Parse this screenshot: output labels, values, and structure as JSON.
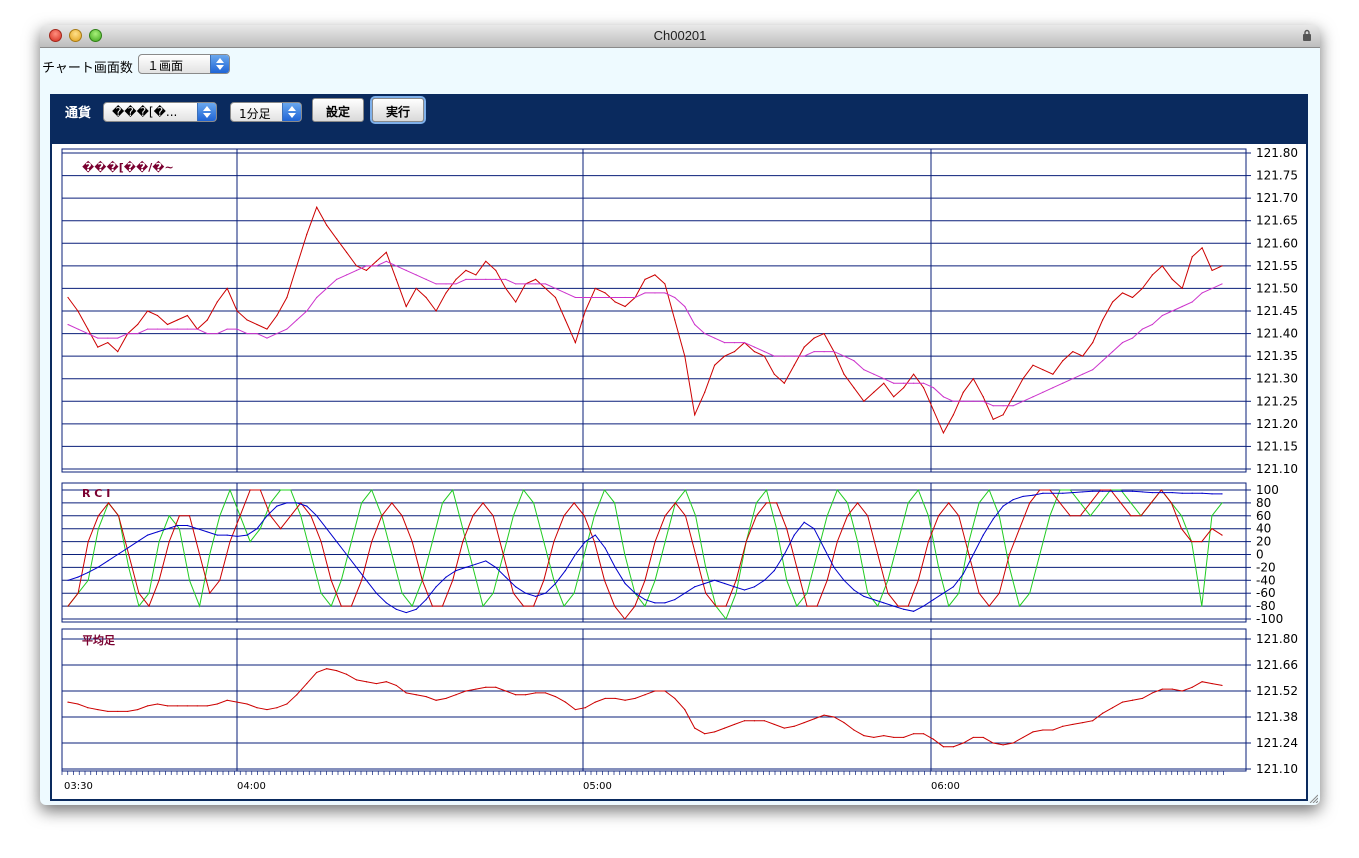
{
  "window": {
    "title": "Ch00201"
  },
  "toolbar": {
    "screen_count_label": "チャート画面数",
    "screen_count_value": "１画面"
  },
  "panel": {
    "currency_label": "通貨",
    "currency_value": "���[�...",
    "timeframe_value": "1分足",
    "settings_button": "設定",
    "execute_button": "実行"
  },
  "chart_data": [
    {
      "type": "line",
      "title": "���[��/�~",
      "ylim": [
        121.1,
        121.8
      ],
      "y_ticks": [
        "121.80",
        "121.75",
        "121.70",
        "121.65",
        "121.60",
        "121.55",
        "121.50",
        "121.45",
        "121.40",
        "121.35",
        "121.30",
        "121.25",
        "121.20",
        "121.15",
        "121.10"
      ],
      "series": [
        {
          "name": "",
          "color": "#cc0000",
          "y": [
            121.48,
            121.45,
            121.41,
            121.37,
            121.38,
            121.36,
            121.4,
            121.42,
            121.45,
            121.44,
            121.42,
            121.43,
            121.44,
            121.41,
            121.43,
            121.47,
            121.5,
            121.45,
            121.43,
            121.42,
            121.41,
            121.44,
            121.48,
            121.55,
            121.62,
            121.68,
            121.64,
            121.61,
            121.58,
            121.55,
            121.54,
            121.56,
            121.58,
            121.52,
            121.46,
            121.5,
            121.48,
            121.45,
            121.49,
            121.52,
            121.54,
            121.53,
            121.56,
            121.54,
            121.5,
            121.47,
            121.51,
            121.52,
            121.5,
            121.48,
            121.43,
            121.38,
            121.45,
            121.5,
            121.49,
            121.47,
            121.46,
            121.48,
            121.52,
            121.53,
            121.51,
            121.43,
            121.35,
            121.22,
            121.27,
            121.33,
            121.35,
            121.36,
            121.38,
            121.36,
            121.35,
            121.31,
            121.29,
            121.33,
            121.37,
            121.39,
            121.4,
            121.36,
            121.31,
            121.28,
            121.25,
            121.27,
            121.29,
            121.26,
            121.28,
            121.31,
            121.28,
            121.23,
            121.18,
            121.22,
            121.27,
            121.3,
            121.26,
            121.21,
            121.22,
            121.26,
            121.3,
            121.33,
            121.32,
            121.31,
            121.34,
            121.36,
            121.35,
            121.38,
            121.43,
            121.47,
            121.49,
            121.48,
            121.5,
            121.53,
            121.55,
            121.52,
            121.5,
            121.57,
            121.59,
            121.54,
            121.55
          ]
        },
        {
          "name": "",
          "color": "#cc33cc",
          "y": [
            121.42,
            121.41,
            121.4,
            121.39,
            121.39,
            121.39,
            121.4,
            121.4,
            121.41,
            121.41,
            121.41,
            121.41,
            121.41,
            121.41,
            121.4,
            121.4,
            121.41,
            121.41,
            121.4,
            121.4,
            121.39,
            121.4,
            121.41,
            121.43,
            121.45,
            121.48,
            121.5,
            121.52,
            121.53,
            121.54,
            121.55,
            121.55,
            121.56,
            121.55,
            121.54,
            121.53,
            121.52,
            121.51,
            121.51,
            121.51,
            121.52,
            121.52,
            121.52,
            121.52,
            121.52,
            121.51,
            121.51,
            121.51,
            121.51,
            121.5,
            121.49,
            121.48,
            121.48,
            121.48,
            121.48,
            121.48,
            121.48,
            121.48,
            121.49,
            121.49,
            121.49,
            121.48,
            121.46,
            121.42,
            121.4,
            121.39,
            121.38,
            121.38,
            121.38,
            121.37,
            121.36,
            121.35,
            121.35,
            121.35,
            121.35,
            121.36,
            121.36,
            121.36,
            121.35,
            121.34,
            121.32,
            121.31,
            121.3,
            121.29,
            121.29,
            121.29,
            121.29,
            121.28,
            121.26,
            121.25,
            121.25,
            121.25,
            121.25,
            121.24,
            121.24,
            121.24,
            121.25,
            121.26,
            121.27,
            121.28,
            121.29,
            121.3,
            121.31,
            121.32,
            121.34,
            121.36,
            121.38,
            121.39,
            121.41,
            121.42,
            121.44,
            121.45,
            121.46,
            121.47,
            121.49,
            121.5,
            121.51
          ]
        }
      ]
    },
    {
      "type": "line",
      "title": "R C I",
      "ylim": [
        -100,
        100
      ],
      "y_ticks": [
        "100",
        "80",
        "60",
        "40",
        "20",
        "0",
        "-20",
        "-40",
        "-60",
        "-80",
        "-100"
      ],
      "series": [
        {
          "name": "",
          "color": "#22cc22",
          "y": [
            -80,
            -60,
            -40,
            40,
            80,
            60,
            -20,
            -80,
            -60,
            20,
            60,
            40,
            -40,
            -80,
            0,
            60,
            100,
            60,
            20,
            40,
            80,
            100,
            100,
            60,
            0,
            -60,
            -80,
            -40,
            20,
            80,
            100,
            60,
            0,
            -60,
            -80,
            -40,
            20,
            80,
            100,
            40,
            -20,
            -80,
            -60,
            0,
            60,
            100,
            80,
            20,
            -40,
            -80,
            -60,
            0,
            60,
            100,
            80,
            0,
            -60,
            -80,
            -40,
            20,
            80,
            100,
            60,
            -20,
            -80,
            -100,
            -60,
            20,
            80,
            100,
            40,
            -40,
            -80,
            -60,
            0,
            60,
            100,
            80,
            20,
            -60,
            -80,
            -40,
            20,
            80,
            100,
            60,
            -20,
            -80,
            -60,
            20,
            80,
            100,
            60,
            -20,
            -80,
            -60,
            0,
            60,
            100,
            100,
            80,
            60,
            80,
            100,
            100,
            80,
            60,
            80,
            100,
            80,
            60,
            20,
            -80,
            60,
            80
          ]
        },
        {
          "name": "",
          "color": "#cc0000",
          "y": [
            -80,
            -60,
            20,
            60,
            80,
            60,
            0,
            -60,
            -80,
            -40,
            20,
            60,
            60,
            0,
            -60,
            -40,
            20,
            60,
            100,
            100,
            60,
            40,
            60,
            80,
            60,
            20,
            -40,
            -80,
            -80,
            -40,
            20,
            60,
            80,
            60,
            20,
            -40,
            -80,
            -80,
            -40,
            20,
            60,
            80,
            60,
            0,
            -60,
            -80,
            -80,
            -40,
            20,
            60,
            80,
            60,
            20,
            -40,
            -80,
            -100,
            -80,
            -40,
            20,
            60,
            80,
            60,
            0,
            -60,
            -80,
            -80,
            -40,
            20,
            60,
            80,
            80,
            40,
            -20,
            -80,
            -80,
            -40,
            20,
            60,
            80,
            60,
            0,
            -60,
            -80,
            -80,
            -40,
            20,
            60,
            80,
            60,
            0,
            -60,
            -80,
            -60,
            0,
            40,
            80,
            100,
            100,
            80,
            60,
            60,
            80,
            100,
            100,
            80,
            60,
            60,
            80,
            100,
            80,
            40,
            20,
            20,
            40,
            30
          ]
        },
        {
          "name": "",
          "color": "#0000cc",
          "y": [
            -40,
            -35,
            -28,
            -20,
            -10,
            0,
            10,
            20,
            30,
            35,
            40,
            45,
            45,
            40,
            35,
            30,
            30,
            28,
            30,
            40,
            60,
            75,
            80,
            80,
            75,
            60,
            40,
            20,
            0,
            -20,
            -40,
            -60,
            -75,
            -85,
            -90,
            -85,
            -70,
            -50,
            -35,
            -25,
            -20,
            -15,
            -10,
            -20,
            -35,
            -50,
            -60,
            -65,
            -60,
            -45,
            -25,
            0,
            20,
            30,
            10,
            -20,
            -45,
            -60,
            -70,
            -75,
            -75,
            -70,
            -60,
            -50,
            -45,
            -40,
            -45,
            -50,
            -55,
            -50,
            -40,
            -25,
            0,
            30,
            50,
            40,
            10,
            -20,
            -40,
            -55,
            -65,
            -70,
            -75,
            -80,
            -85,
            -88,
            -80,
            -70,
            -60,
            -50,
            -30,
            0,
            30,
            55,
            75,
            85,
            90,
            92,
            95,
            95,
            95,
            96,
            97,
            98,
            98,
            98,
            98,
            98,
            97,
            96,
            96,
            96,
            95,
            95,
            95,
            94,
            94
          ]
        }
      ]
    },
    {
      "type": "line",
      "title": "平均足",
      "ylim": [
        121.1,
        121.8
      ],
      "y_ticks": [
        "121.80",
        "121.66",
        "121.52",
        "121.38",
        "121.24",
        "121.10"
      ],
      "series": [
        {
          "name": "",
          "color": "#cc0000",
          "y": [
            121.46,
            121.45,
            121.43,
            121.42,
            121.41,
            121.41,
            121.41,
            121.42,
            121.44,
            121.45,
            121.44,
            121.44,
            121.44,
            121.44,
            121.44,
            121.45,
            121.47,
            121.46,
            121.45,
            121.43,
            121.42,
            121.43,
            121.45,
            121.5,
            121.56,
            121.62,
            121.64,
            121.63,
            121.61,
            121.58,
            121.57,
            121.56,
            121.57,
            121.55,
            121.51,
            121.5,
            121.49,
            121.47,
            121.48,
            121.5,
            121.52,
            121.53,
            121.54,
            121.54,
            121.52,
            121.5,
            121.5,
            121.51,
            121.51,
            121.49,
            121.46,
            121.42,
            121.43,
            121.46,
            121.48,
            121.48,
            121.47,
            121.48,
            121.5,
            121.52,
            121.52,
            121.48,
            121.42,
            121.32,
            121.29,
            121.3,
            121.32,
            121.34,
            121.36,
            121.36,
            121.36,
            121.34,
            121.32,
            121.33,
            121.35,
            121.37,
            121.39,
            121.38,
            121.35,
            121.31,
            121.28,
            121.27,
            121.28,
            121.27,
            121.27,
            121.29,
            121.29,
            121.26,
            121.22,
            121.22,
            121.24,
            121.27,
            121.27,
            121.24,
            121.23,
            121.24,
            121.27,
            121.3,
            121.31,
            121.31,
            121.33,
            121.34,
            121.35,
            121.36,
            121.4,
            121.43,
            121.46,
            121.47,
            121.48,
            121.51,
            121.53,
            121.53,
            121.52,
            121.54,
            121.57,
            121.56,
            121.55
          ]
        }
      ]
    }
  ],
  "x_axis": {
    "labels": [
      "03:30",
      "04:00",
      "05:00",
      "06:00"
    ]
  }
}
